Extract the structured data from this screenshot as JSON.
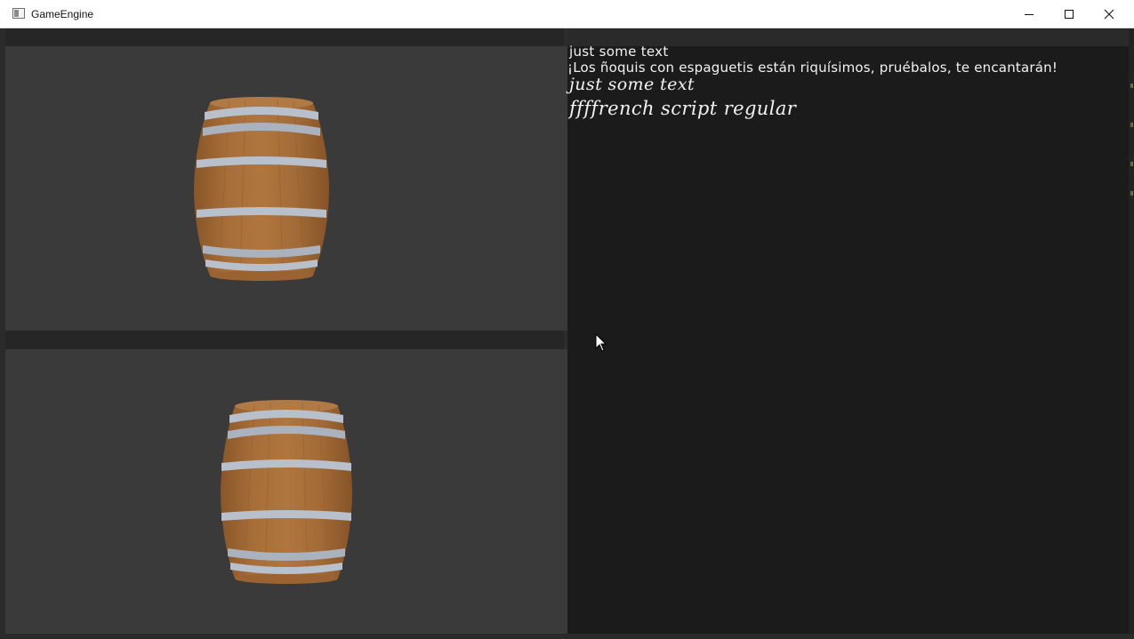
{
  "window": {
    "title": "GameEngine",
    "icon": "app-window-icon",
    "controls": [
      "minimize-icon",
      "maximize-icon",
      "close-icon"
    ]
  },
  "scene": {
    "top_viewport": {
      "object": "barrel"
    },
    "bottom_viewport": {
      "object": "barrel"
    }
  },
  "text_panel": {
    "lines": [
      "just some text",
      "¡Los ñoquis con espaguetis están riquísimos, pruébalos, te encantarán!",
      "just some text",
      "ffffrench script regular"
    ]
  },
  "colors": {
    "viewport_bg": "#3a3a3a",
    "panel_bg": "#1b1b1b",
    "barrel_wood": "#a06a36",
    "barrel_band": "#b7bfca",
    "text": "#f2f2f2"
  }
}
